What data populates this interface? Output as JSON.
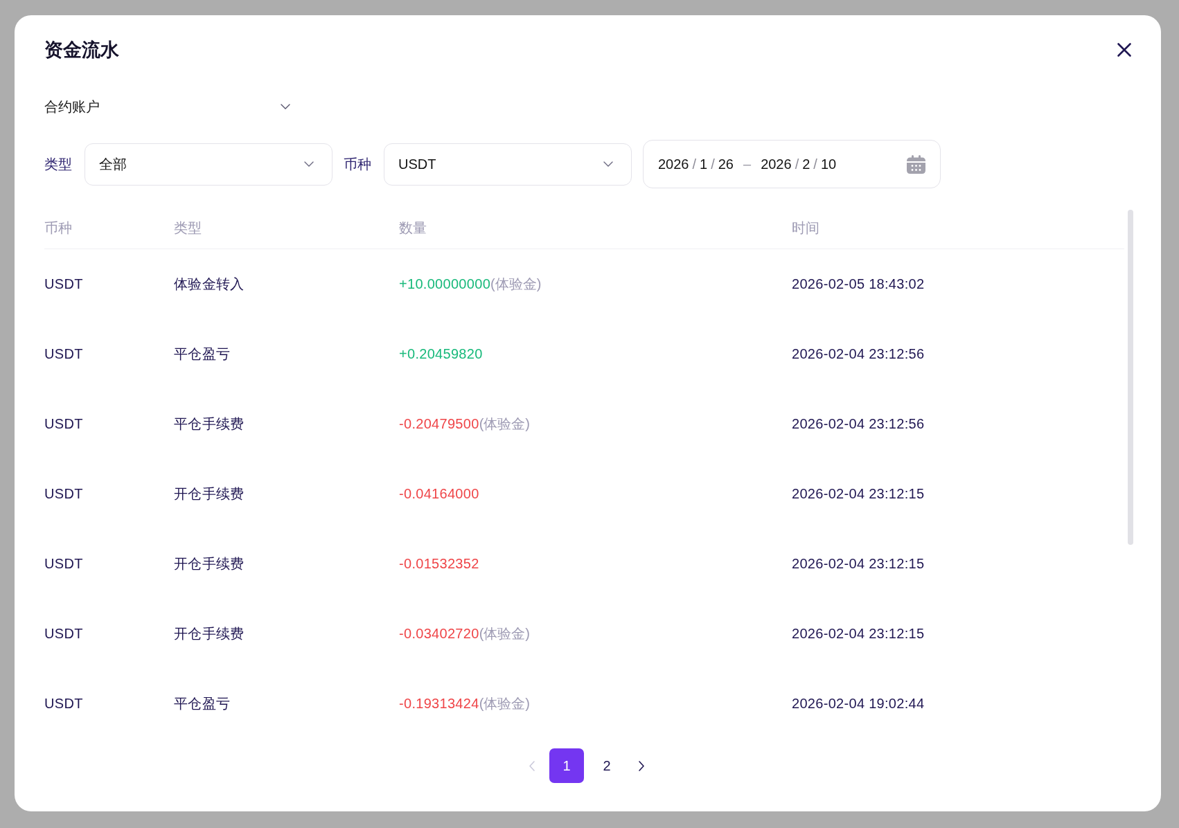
{
  "dialog": {
    "title": "资金流水"
  },
  "account_dropdown": {
    "value": "合约账户"
  },
  "filters": [
    {
      "label": "类型",
      "value": "全部"
    },
    {
      "label": "币种",
      "value": "USDT"
    }
  ],
  "date_range": {
    "start": [
      {
        "text": "2026",
        "kind": "number"
      },
      {
        "text": "/",
        "kind": "separator"
      },
      {
        "text": "1",
        "kind": "number"
      },
      {
        "text": "/",
        "kind": "separator"
      },
      {
        "text": "26",
        "kind": "number"
      }
    ],
    "separator": "–",
    "end": [
      {
        "text": "2026",
        "kind": "number"
      },
      {
        "text": "/",
        "kind": "separator"
      },
      {
        "text": "2",
        "kind": "number"
      },
      {
        "text": "/",
        "kind": "separator"
      },
      {
        "text": "10",
        "kind": "number"
      }
    ]
  },
  "table": {
    "columns": [
      "币种",
      "类型",
      "数量",
      "时间"
    ],
    "rows": [
      {
        "currency": "USDT",
        "type": "体验金转入",
        "amount": "+10.00000000",
        "kind": "credit",
        "note": "(体验金)",
        "time": "2026-02-05 18:43:02"
      },
      {
        "currency": "USDT",
        "type": "平仓盈亏",
        "amount": "+0.20459820",
        "kind": "credit",
        "time": "2026-02-04 23:12:56"
      },
      {
        "currency": "USDT",
        "type": "平仓手续费",
        "amount": "-0.20479500",
        "kind": "debit",
        "note": "(体验金)",
        "time": "2026-02-04 23:12:56"
      },
      {
        "currency": "USDT",
        "type": "开仓手续费",
        "amount": "-0.04164000",
        "kind": "debit",
        "time": "2026-02-04 23:12:15"
      },
      {
        "currency": "USDT",
        "type": "开仓手续费",
        "amount": "-0.01532352",
        "kind": "debit",
        "time": "2026-02-04 23:12:15"
      },
      {
        "currency": "USDT",
        "type": "开仓手续费",
        "amount": "-0.03402720",
        "kind": "debit",
        "note": "(体验金)",
        "time": "2026-02-04 23:12:15"
      },
      {
        "currency": "USDT",
        "type": "平仓盈亏",
        "amount": "-0.19313424",
        "kind": "debit",
        "note": "(体验金)",
        "time": "2026-02-04 19:02:44"
      }
    ]
  },
  "pagination": {
    "previous": {
      "disabled": true
    },
    "pages": [
      {
        "label": "1",
        "selected": true
      },
      {
        "label": "2",
        "selected": false
      }
    ],
    "next": {
      "disabled": false
    }
  }
}
